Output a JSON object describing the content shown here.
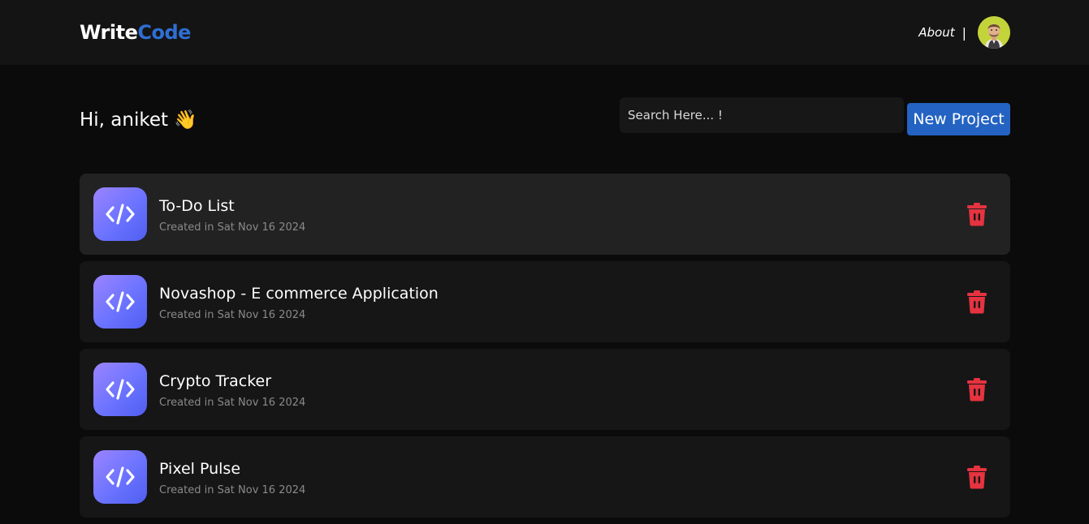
{
  "navbar": {
    "logo_part1": "Write",
    "logo_part2": "Code",
    "about_label": "About",
    "separator": "|",
    "avatar_icon": "user-avatar-icon"
  },
  "main": {
    "greeting": "Hi, aniket 👋",
    "search": {
      "placeholder": "Search Here... !",
      "value": ""
    },
    "new_project_label": "New Project"
  },
  "projects": [
    {
      "title": "To-Do List",
      "date": "Created in Sat Nov 16 2024"
    },
    {
      "title": "Novashop - E commerce Application",
      "date": "Created in Sat Nov 16 2024"
    },
    {
      "title": "Crypto Tracker",
      "date": "Created in Sat Nov 16 2024"
    },
    {
      "title": "Pixel Pulse",
      "date": "Created in Sat Nov 16 2024"
    }
  ],
  "colors": {
    "background": "#0b0b0b",
    "navbar": "#141414",
    "accent": "#2463c2",
    "logo_accent": "#2f6ed3",
    "delete": "#e5333f",
    "card": "#161616",
    "card_active": "#222222"
  },
  "icons": {
    "project": "code-icon",
    "delete": "trash-icon"
  }
}
